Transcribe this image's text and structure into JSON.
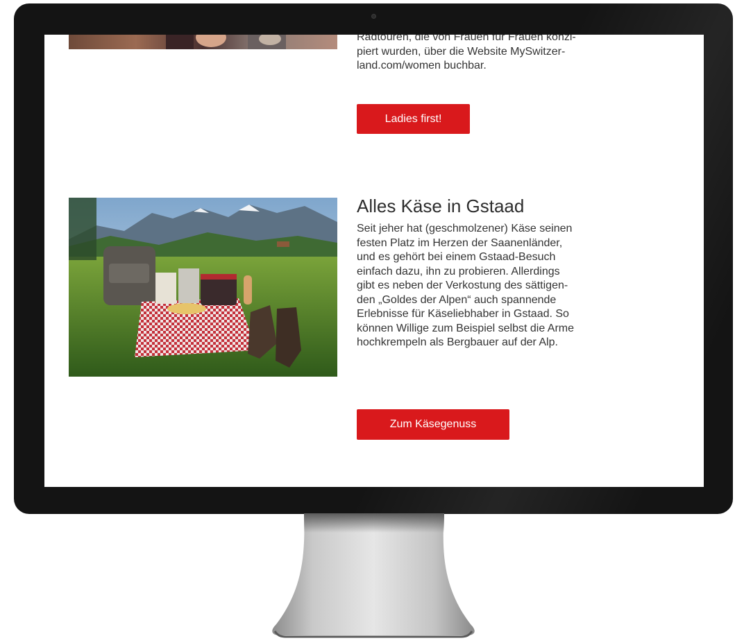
{
  "article_top": {
    "body_lines": [
      "Radtouren, die von Frauen für Frauen konzi-",
      "piert wurden, über die Website MySwitzer-",
      "land.com/women  buchbar."
    ],
    "button_label": "Ladies first!"
  },
  "article_kase": {
    "title": "Alles Käse in Gstaad",
    "body_lines": [
      "Seit jeher hat (geschmolzener) Käse seinen",
      "festen Platz im Herzen der Saanenländer,",
      "und es gehört bei einem Gstaad-Besuch",
      "einfach dazu, ihn zu probieren. Allerdings",
      "gibt es neben der Verkostung des sättigen-",
      "den „Goldes der Alpen“ auch spannende",
      "Erlebnisse für Käseliebhaber in Gstaad. So",
      "können Willige zum Beispiel selbst die Arme",
      "hochkrempeln als Bergbauer auf der Alp."
    ],
    "button_label": "Zum Käsegenuss"
  },
  "colors": {
    "button_red": "#d9191c",
    "text": "#333333",
    "bezel": "#141414"
  }
}
